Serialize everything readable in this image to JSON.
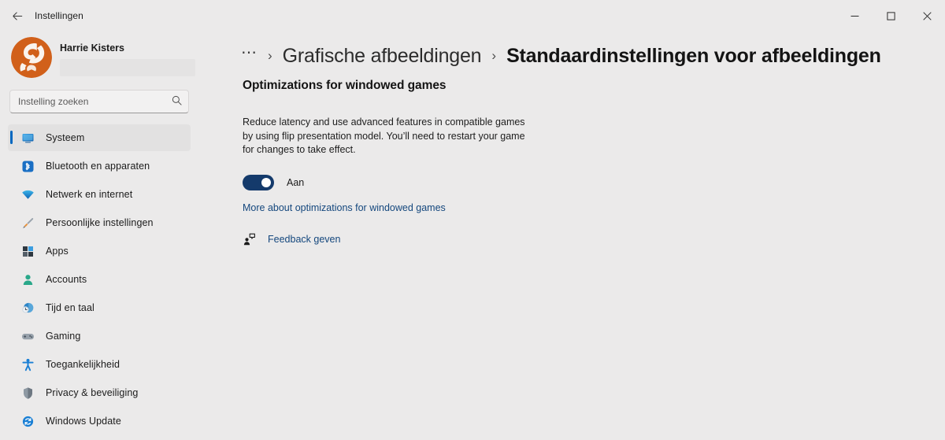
{
  "window": {
    "app_title": "Instellingen",
    "back_icon": "back-arrow-icon",
    "controls": {
      "minimize": "─",
      "maximize": "☐",
      "close": "✕"
    }
  },
  "sidebar": {
    "account": {
      "name": "Harrie Kisters",
      "avatar_icon": "user-avatar-logo",
      "avatar_color": "#d1601a"
    },
    "search": {
      "placeholder": "Instelling zoeken",
      "value": "",
      "icon": "search-icon"
    },
    "items": [
      {
        "label": "Systeem",
        "icon": "display-monitor-icon",
        "selected": true
      },
      {
        "label": "Bluetooth en apparaten",
        "icon": "bluetooth-icon",
        "selected": false
      },
      {
        "label": "Netwerk en internet",
        "icon": "wifi-icon",
        "selected": false
      },
      {
        "label": "Persoonlijke instellingen",
        "icon": "paintbrush-icon",
        "selected": false
      },
      {
        "label": "Apps",
        "icon": "apps-grid-icon",
        "selected": false
      },
      {
        "label": "Accounts",
        "icon": "person-icon",
        "selected": false
      },
      {
        "label": "Tijd en taal",
        "icon": "globe-clock-icon",
        "selected": false
      },
      {
        "label": "Gaming",
        "icon": "gamepad-icon",
        "selected": false
      },
      {
        "label": "Toegankelijkheid",
        "icon": "accessibility-person-icon",
        "selected": false
      },
      {
        "label": "Privacy & beveiliging",
        "icon": "shield-icon",
        "selected": false
      },
      {
        "label": "Windows Update",
        "icon": "update-refresh-icon",
        "selected": false
      }
    ],
    "accent_color": "#0067c0"
  },
  "breadcrumb": {
    "overflow": "⋯",
    "separator": "›",
    "parent": "Grafische afbeeldingen",
    "current": "Standaardinstellingen voor afbeeldingen"
  },
  "main": {
    "section_title": "Optimizations for windowed games",
    "section_description": "Reduce latency and use advanced features in compatible games by using flip presentation model. You’ll need to restart your game for changes to take effect.",
    "toggle": {
      "state_label": "Aan",
      "on": true,
      "on_color": "#143a6b"
    },
    "learn_more_link": "More about optimizations for windowed games",
    "feedback": {
      "label": "Feedback geven",
      "icon": "feedback-person-icon"
    },
    "link_color": "#14477d"
  }
}
